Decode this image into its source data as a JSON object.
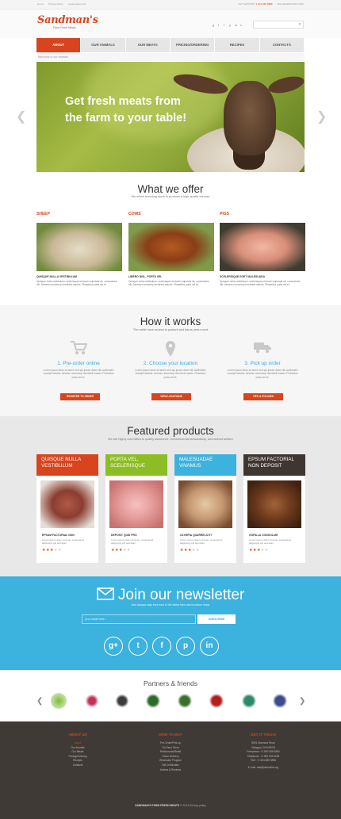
{
  "topbar": {
    "links": [
      "Home",
      "Privacy Policy",
      "Legal Agreement"
    ],
    "support_label": "24/7 SUPPORT:",
    "phone": "1 919 666 8888",
    "email": "MAIL@DEMOLINK.ORG"
  },
  "brand": {
    "name": "Sandman's",
    "tagline": "Farm Fresh Meats"
  },
  "search": {
    "placeholder": ""
  },
  "nav": {
    "items": [
      "ABOUT",
      "OUR ANIMALS",
      "OUR MEATS",
      "PRICING/ORDERING",
      "RECIPES",
      "CONTACTS"
    ],
    "active_index": 0
  },
  "welcome": "Welcome to our website!",
  "hero": {
    "headline": "Get fresh meats from the farm to your table!"
  },
  "offer": {
    "title": "What we offer",
    "subtitle": "We select breeding stock to produce a high quality carcass",
    "items": [
      {
        "label": "SHEEP",
        "title": "QUISQUE NULLA VESTIBULUM",
        "text": "Quisque nulla vestibulum, scelerisque sit amet vulputate sit, consectetur elit. Aenean nonummy hendrerit mauris. Phasellus porta vel et."
      },
      {
        "label": "COWS",
        "title": "LIBERO NISL, PORTA VEL",
        "text": "Quisque nulla vestibulum, scelerisque sit amet vulputate sit, consectetur elit. Aenean nonummy hendrerit mauris. Phasellus porta vel et."
      },
      {
        "label": "PIGS",
        "title": "SCELERISQUE EGET MALESUADA",
        "text": "Quisque nulla vestibulum, scelerisque sit amet vulputate sit, consectetur elit. Aenean nonummy hendrerit mauris. Phasellus porta vel et."
      }
    ]
  },
  "how": {
    "title": "How it works",
    "subtitle": "The cattle have access to pasture and barns year-round",
    "steps": [
      {
        "title": "1. Pre-order online",
        "text": "Lorem ipsum dolor sit amet, sed qui ipsum dolor elit, sollicitudin suscipit lobortis. Aenean nonummy hendrerit mauris. Phasellus porta vel et.",
        "button": "REGISTER TO ORDER"
      },
      {
        "title": "2. Choose your location",
        "text": "Lorem ipsum dolor sit amet, sed qui ipsum dolor elit, sollicitudin suscipit lobortis. Aenean nonummy hendrerit mauris. Phasellus porta vel et.",
        "button": "VIEW LOCATIONS"
      },
      {
        "title": "3. Pick up order",
        "text": "Lorem ipsum dolor sit amet, sed qui ipsum dolor elit, sollicitudin suscipit lobortis. Aenean nonummy hendrerit mauris. Phasellus porta vel et.",
        "button": "TIPS & POLICIES"
      }
    ]
  },
  "featured": {
    "title": "Featured products",
    "subtitle": "We are highly committed to quality assurance, environmental stewardship, and animal welfare",
    "products": [
      {
        "heading": "QUISQUE NULLA VESTIBULUM",
        "name": "EPSUM FACTORIAL NON",
        "text": "Lorem ipsum dolor sit amet, consectetur adipiscing elit sed diam.",
        "rating": 3,
        "color": "#d8441e"
      },
      {
        "heading": "PORTA VEL, SCELERISQUE",
        "name": "DEPOSIT QUID PRO",
        "text": "Lorem ipsum dolor sit amet, consectetur adipiscing elit sed diam.",
        "rating": 3,
        "color": "#8cbd24"
      },
      {
        "heading": "MALESUADAE VIVAMUS",
        "name": "OLYMPIA QUARRELS ET",
        "text": "Lorem ipsum dolor sit amet, consectetur adipiscing elit sed diam.",
        "rating": 3,
        "color": "#3cb2de"
      },
      {
        "heading": "EPSUM FACTORIAL NON DEPOSIT",
        "name": "GORILLA CONGOLUM",
        "text": "Lorem ipsum dolor sit amet, consectetur adipiscing elit sed diam.",
        "rating": 3,
        "color": "#3e3631"
      }
    ]
  },
  "newsletter": {
    "title": "Join our newsletter",
    "subtitle": "And always stay informed of the latest farm and location news",
    "input_placeholder": "your email here...",
    "button": "SUBSCRIBE",
    "social": [
      "g+",
      "twitter",
      "f",
      "pinterest",
      "in"
    ]
  },
  "partners": {
    "title": "Partners & friends"
  },
  "footer": {
    "about": {
      "heading": "ABOUT US",
      "links": [
        "About",
        "Our Animals",
        "Our Meats",
        "Pricing/Ordering",
        "Recipes",
        "Contacts"
      ]
    },
    "buy": {
      "heading": "HOW TO BUY",
      "links": [
        "Pre-Order/Pick-up",
        "On Farm Store",
        "Restaurants/Retail",
        "Home Delivery",
        "Wholesale Program",
        "Gift Certificates",
        "Articles & Reviews"
      ]
    },
    "contact": {
      "heading": "GET IT TOUCH",
      "address": [
        "8901 Marmora Road",
        "Glasgow, DO4 89GR"
      ],
      "freephone": "Freephone: +1 800 559 6580",
      "telephone": "Telephone: +1 959 603 6035",
      "fax": "FAX: +1 504 889 9898",
      "email": "E-mail: mail@demolink.org"
    },
    "copyright_brand": "SANDMAN'S FARM FRESH MEATS",
    "copyright_rest": "© 2014 Privacy policy"
  },
  "colors": {
    "accent": "#d8441e",
    "blue": "#3cb2de",
    "green": "#8cbd24",
    "dark": "#403a36"
  }
}
